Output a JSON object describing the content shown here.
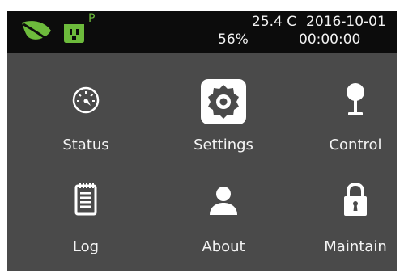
{
  "status_bar": {
    "temperature": "25.4 C",
    "date": "2016-10-01",
    "humidity": "56%",
    "time": "00:00:00",
    "plug_flag": "P",
    "icons": [
      "leaf-icon",
      "power-socket-icon"
    ],
    "accent_color": "#6dbb3c"
  },
  "menu": {
    "items": [
      {
        "label": "Status",
        "icon": "gauge-icon"
      },
      {
        "label": "Settings",
        "icon": "gear-icon"
      },
      {
        "label": "Control",
        "icon": "joystick-icon"
      },
      {
        "label": "Log",
        "icon": "notepad-icon"
      },
      {
        "label": "About",
        "icon": "person-icon"
      },
      {
        "label": "Maintain",
        "icon": "padlock-icon"
      }
    ]
  }
}
